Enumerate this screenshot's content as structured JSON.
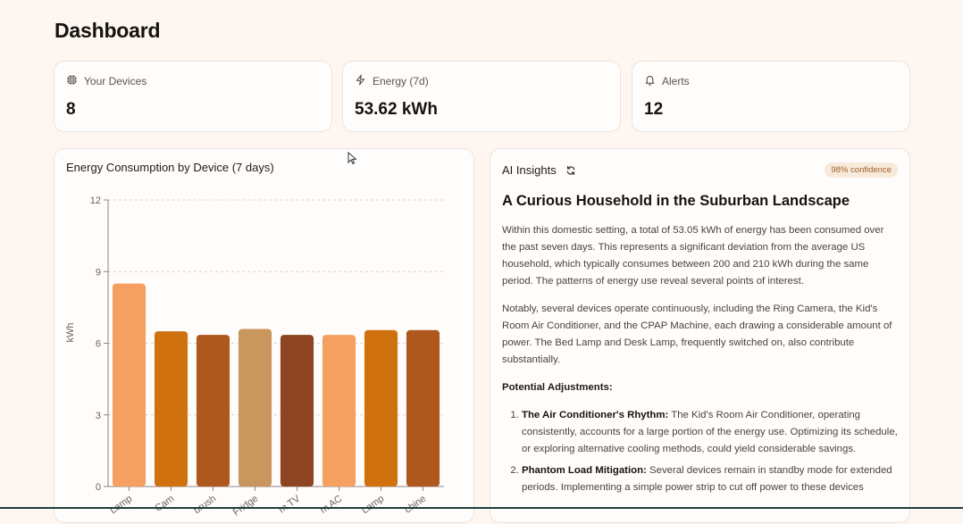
{
  "page": {
    "title": "Dashboard"
  },
  "stats": [
    {
      "label": "Your Devices",
      "value": "8",
      "icon": "chip-icon"
    },
    {
      "label": "Energy (7d)",
      "value": "53.62 kWh",
      "icon": "lightning-icon"
    },
    {
      "label": "Alerts",
      "value": "12",
      "icon": "bell-icon"
    }
  ],
  "chart": {
    "title": "Energy Consumption by Device (7 days)"
  },
  "chart_data": {
    "type": "bar",
    "title": "Energy Consumption by Device (7 days)",
    "ylabel": "kWh",
    "xlabel": "",
    "ylim": [
      0,
      12
    ],
    "yticks": [
      "0",
      "3",
      "6",
      "9",
      "12"
    ],
    "grid": true,
    "categories": [
      "Lamp",
      "Cam",
      "brush",
      "Fridge",
      "m TV",
      "m AC",
      "Lamp",
      "chine"
    ],
    "values": [
      8.5,
      6.5,
      6.35,
      6.6,
      6.35,
      6.35,
      6.55,
      6.55
    ],
    "colors": [
      "#f5a061",
      "#d07110",
      "#ae581d",
      "#c9975e",
      "#8d4420",
      "#f5a061",
      "#d07110",
      "#ae581d"
    ]
  },
  "insights": {
    "header": "AI Insights",
    "confidence": "98% confidence",
    "title": "A Curious Household in the Suburban Landscape",
    "para1": "Within this domestic setting, a total of 53.05 kWh of energy has been consumed over the past seven days. This represents a significant deviation from the average US household, which typically consumes between 200 and 210 kWh during the same period. The patterns of energy use reveal several points of interest.",
    "para2": "Notably, several devices operate continuously, including the Ring Camera, the Kid's Room Air Conditioner, and the CPAP Machine, each drawing a considerable amount of power. The Bed Lamp and Desk Lamp, frequently switched on, also contribute substantially.",
    "subheading": "Potential Adjustments:",
    "items": [
      {
        "title": "The Air Conditioner's Rhythm:",
        "text": "The Kid's Room Air Conditioner, operating consistently, accounts for a large portion of the energy use. Optimizing its schedule, or exploring alternative cooling methods, could yield considerable savings."
      },
      {
        "title": "Phantom Load Mitigation:",
        "text": "Several devices remain in standby mode for extended periods. Implementing a simple power strip to cut off power to these devices"
      }
    ]
  }
}
